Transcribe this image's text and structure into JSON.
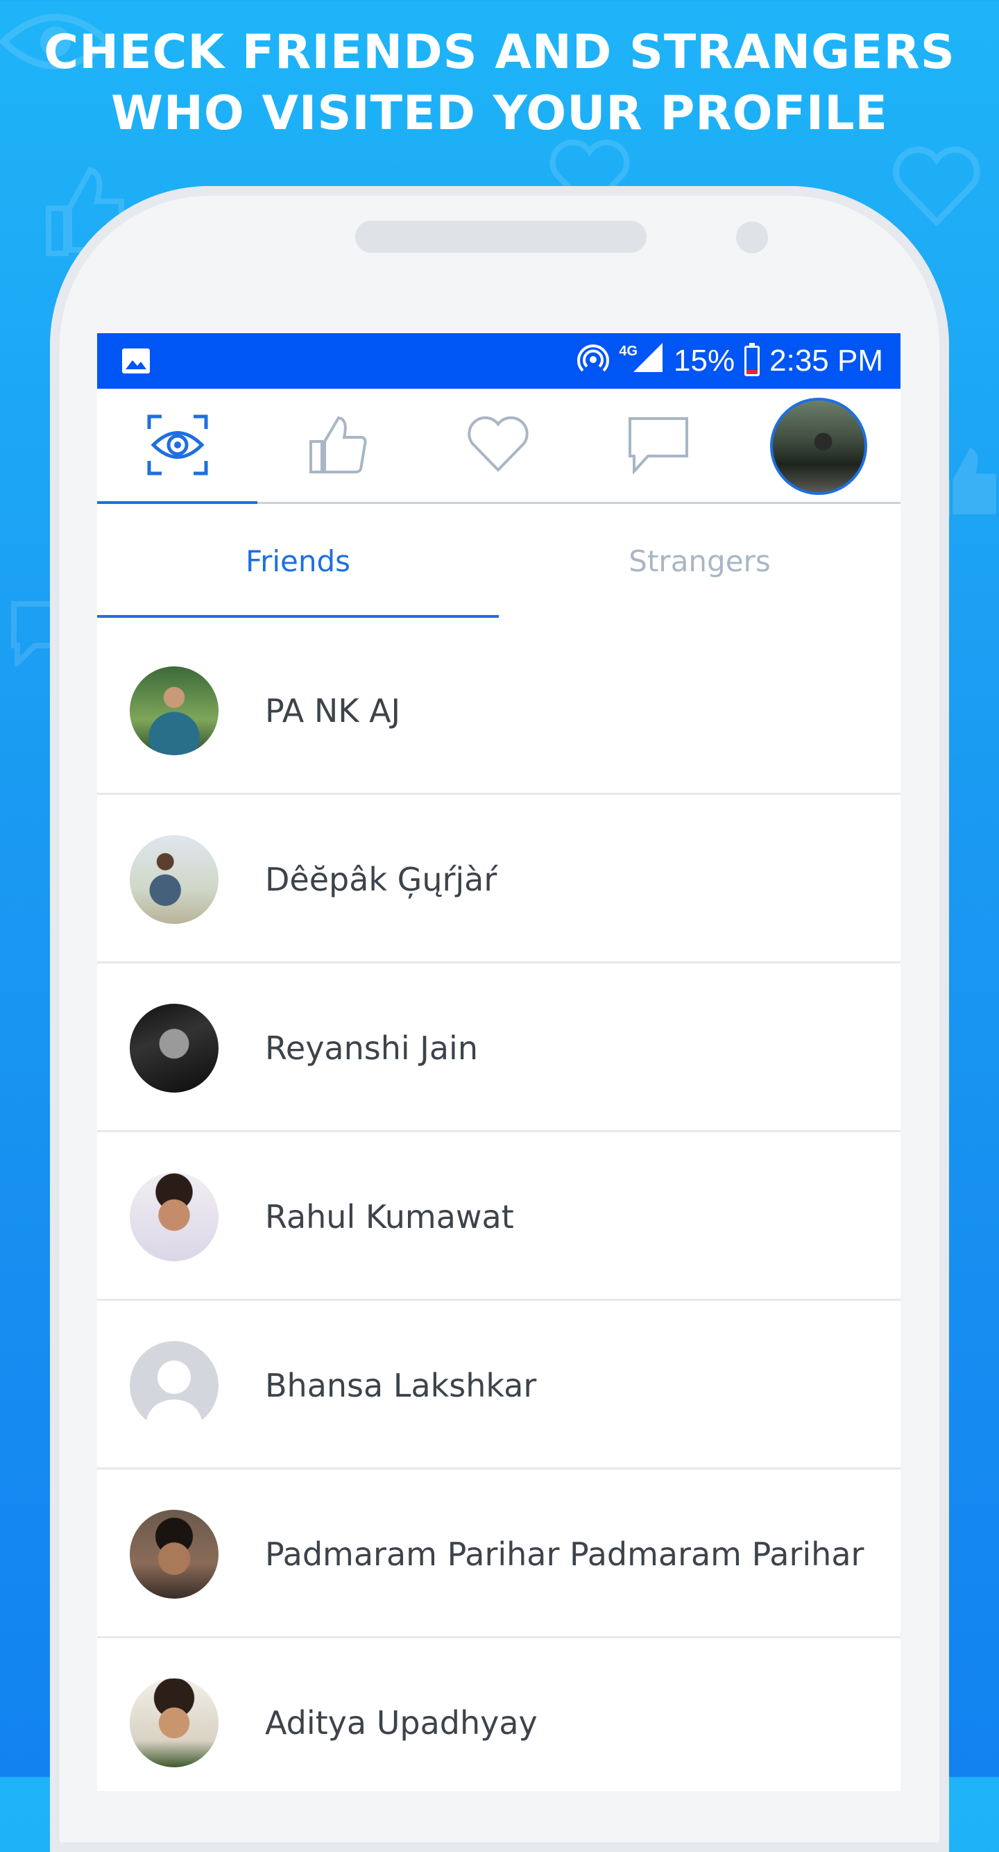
{
  "headline": {
    "line1": "CHECK FRIENDS AND STRANGERS",
    "line2": "WHO VISITED YOUR PROFILE"
  },
  "status_bar": {
    "network": "4G",
    "battery": "15%",
    "battery_level": 0.15,
    "time": "2:35 PM",
    "icons": [
      "image-icon",
      "hotspot-icon",
      "signal-icon",
      "battery-icon"
    ]
  },
  "top_nav": {
    "active_index": 0,
    "items": [
      "eye-scan-icon",
      "thumbs-up-icon",
      "heart-icon",
      "chat-icon",
      "profile-avatar"
    ]
  },
  "tabs": {
    "friends": "Friends",
    "strangers": "Strangers",
    "active": "friends"
  },
  "friends": [
    {
      "name": "PA NK AJ"
    },
    {
      "name": "Dêĕpâk Ģųŕjàŕ"
    },
    {
      "name": "Reyanshi Jain"
    },
    {
      "name": "Rahul Kumawat"
    },
    {
      "name": "Bhansa Lakshkar"
    },
    {
      "name": "Padmaram Parihar Padmaram Parihar"
    },
    {
      "name": "Aditya Upadhyay"
    }
  ],
  "colors": {
    "accent": "#1e6fe0",
    "status_bar": "#0055f5",
    "inactive_tab": "#a9b6c4",
    "name_text": "#3d434b"
  }
}
